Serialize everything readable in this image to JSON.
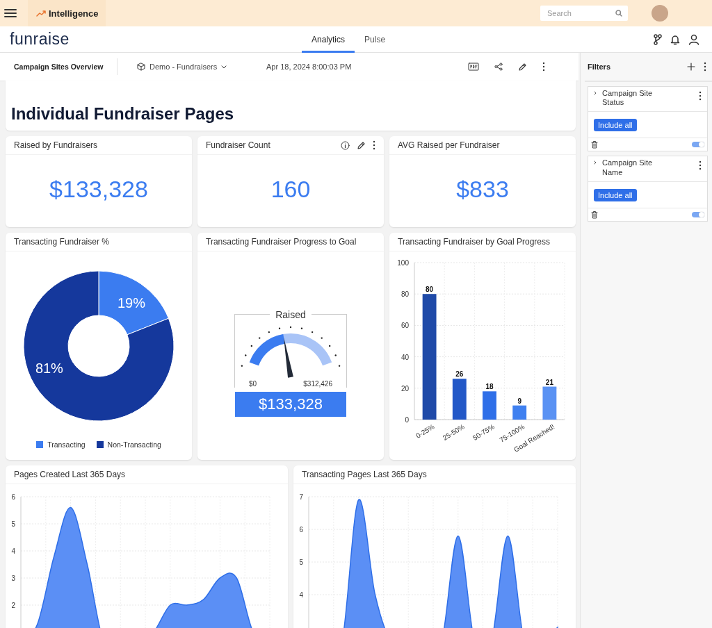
{
  "top_bar": {
    "app_title": "Intelligence",
    "search": {
      "placeholder": "Search"
    }
  },
  "header": {
    "logo": "funraise",
    "tabs": [
      {
        "label": "Analytics",
        "selected": true
      },
      {
        "label": "Pulse",
        "selected": false
      }
    ]
  },
  "toolbar": {
    "title": "Campaign Sites Overview",
    "datasource": "Demo - Fundraisers",
    "timestamp": "Apr 18, 2024 8:00:03 PM"
  },
  "dashboard": {
    "title": "Individual Fundraiser Pages",
    "kpis": [
      {
        "title": "Raised by Fundraisers",
        "value": "$133,328",
        "show_actions": false
      },
      {
        "title": "Fundraiser Count",
        "value": "160",
        "show_actions": true
      },
      {
        "title": "AVG Raised per Fundraiser",
        "value": "$833",
        "show_actions": false
      }
    ],
    "donut": {
      "title": "Transacting Fundraiser %",
      "chart_data": {
        "type": "donut",
        "categories": [
          "Transacting",
          "Non-Transacting"
        ],
        "values": [
          19,
          81
        ],
        "colors": [
          "#3b7cf0",
          "#15389c"
        ],
        "value_labels": [
          "19%",
          "81%"
        ]
      }
    },
    "gauge": {
      "title": "Transacting Fundraiser Progress to Goal",
      "label": "Raised",
      "min": "$0",
      "max": "$312,426",
      "value": "$133,328",
      "level": 0.43
    },
    "bar": {
      "title": "Transacting Fundraiser by Goal Progress",
      "chart_data": {
        "type": "bar",
        "categories": [
          "0-25%",
          "25-50%",
          "50-75%",
          "75-100%",
          "Goal Reached!"
        ],
        "values": [
          80,
          26,
          18,
          9,
          21
        ],
        "colors": [
          "#1f4aa8",
          "#2358c7",
          "#2f6fe8",
          "#3f80f0",
          "#5a92f3"
        ],
        "ylim": [
          0,
          100
        ],
        "yticks": [
          0,
          20,
          40,
          60,
          80,
          100
        ],
        "data_labels": true,
        "grid": true
      }
    },
    "areas": [
      {
        "title": "Pages Created Last 365 Days",
        "kind": "plateau",
        "y_labels": [
          "6",
          "5",
          "4",
          "3",
          "2"
        ]
      },
      {
        "title": "Transacting Pages Last 365 Days",
        "kind": "peaks",
        "y_labels": [
          "7",
          "6",
          "5",
          "4"
        ]
      }
    ]
  },
  "filters": {
    "title": "Filters",
    "items": [
      {
        "name": "Campaign Site Status",
        "button": "Include all",
        "on": true
      },
      {
        "name": "Campaign Site Name",
        "button": "Include all",
        "on": true
      }
    ]
  }
}
